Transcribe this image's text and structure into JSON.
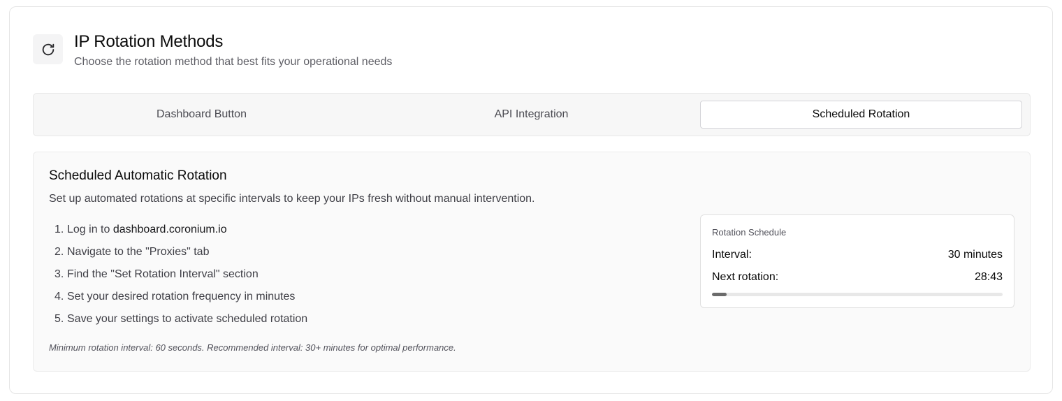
{
  "header": {
    "icon": "refresh-icon",
    "title": "IP Rotation Methods",
    "subtitle": "Choose the rotation method that best fits your operational needs"
  },
  "tabs": [
    {
      "label": "Dashboard Button",
      "active": false
    },
    {
      "label": "API Integration",
      "active": false
    },
    {
      "label": "Scheduled Rotation",
      "active": true
    }
  ],
  "panel": {
    "title": "Scheduled Automatic Rotation",
    "description": "Set up automated rotations at specific intervals to keep your IPs fresh without manual intervention.",
    "steps": [
      {
        "num": "1.",
        "prefix": "Log in to ",
        "strong": "dashboard.coronium.io"
      },
      {
        "num": "2.",
        "prefix": "Navigate to the \"Proxies\" tab",
        "strong": ""
      },
      {
        "num": "3.",
        "prefix": "Find the \"Set Rotation Interval\" section",
        "strong": ""
      },
      {
        "num": "4.",
        "prefix": "Set your desired rotation frequency in minutes",
        "strong": ""
      },
      {
        "num": "5.",
        "prefix": "Save your settings to activate scheduled rotation",
        "strong": ""
      }
    ],
    "note": "Minimum rotation interval: 60 seconds. Recommended interval: 30+ minutes for optimal performance."
  },
  "schedule": {
    "label": "Rotation Schedule",
    "interval_label": "Interval:",
    "interval_value": "30 minutes",
    "next_label": "Next rotation:",
    "next_value": "28:43",
    "progress_fraction": 0.05
  }
}
